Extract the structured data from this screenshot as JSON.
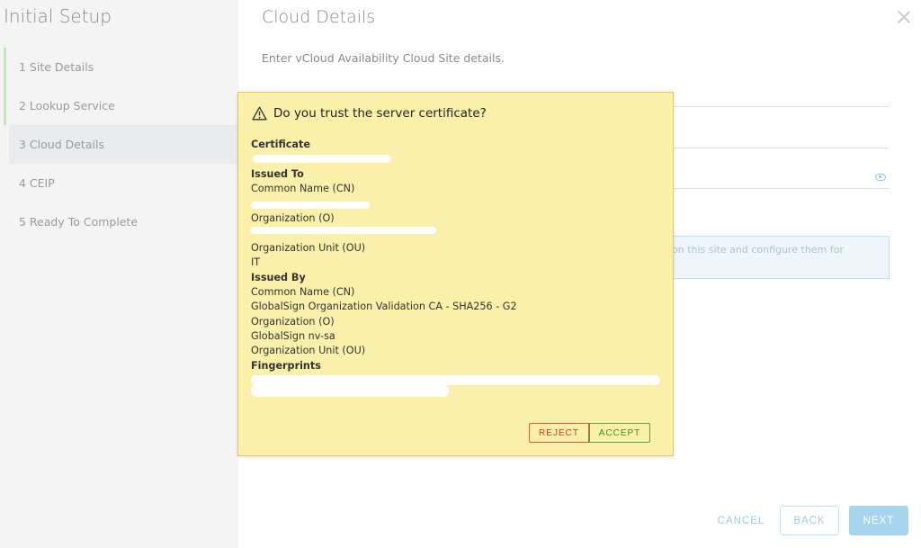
{
  "sidebar": {
    "title": "Initial Setup",
    "steps": [
      {
        "label": "1  Site Details"
      },
      {
        "label": "2  Lookup Service"
      },
      {
        "label": "3  Cloud Details"
      },
      {
        "label": "4  CEIP"
      },
      {
        "label": "5  Ready To Complete"
      }
    ]
  },
  "main": {
    "title": "Cloud Details",
    "subtitle": "Enter vCloud Availability Cloud Site details.",
    "info_text": "on this site and configure them for"
  },
  "footer": {
    "cancel_label": "CANCEL",
    "back_label": "BACK",
    "next_label": "NEXT"
  },
  "dialog": {
    "title": "Do you trust the server certificate?",
    "certificate_heading": "Certificate",
    "issued_to_heading": "Issued To",
    "issued_to": {
      "cn_label": "Common Name (CN)",
      "o_label": "Organization (O)",
      "ou_label": "Organization Unit (OU)",
      "ou_value": "IT"
    },
    "issued_by_heading": "Issued By",
    "issued_by": {
      "cn_label": "Common Name (CN)",
      "cn_value": "GlobalSign Organization Validation CA - SHA256 - G2",
      "o_label": "Organization (O)",
      "o_value": "GlobalSign nv-sa",
      "ou_label": "Organization Unit (OU)"
    },
    "fingerprints_heading": "Fingerprints",
    "reject_label": "REJECT",
    "accept_label": "ACCEPT"
  },
  "colors": {
    "dialog_bg": "#fbf0a9",
    "dialog_border": "#e9c46a",
    "reject": "#c7372f",
    "accept": "#3e8b22",
    "primary": "#a7d5ee",
    "step_done": "#c4e3bf"
  }
}
